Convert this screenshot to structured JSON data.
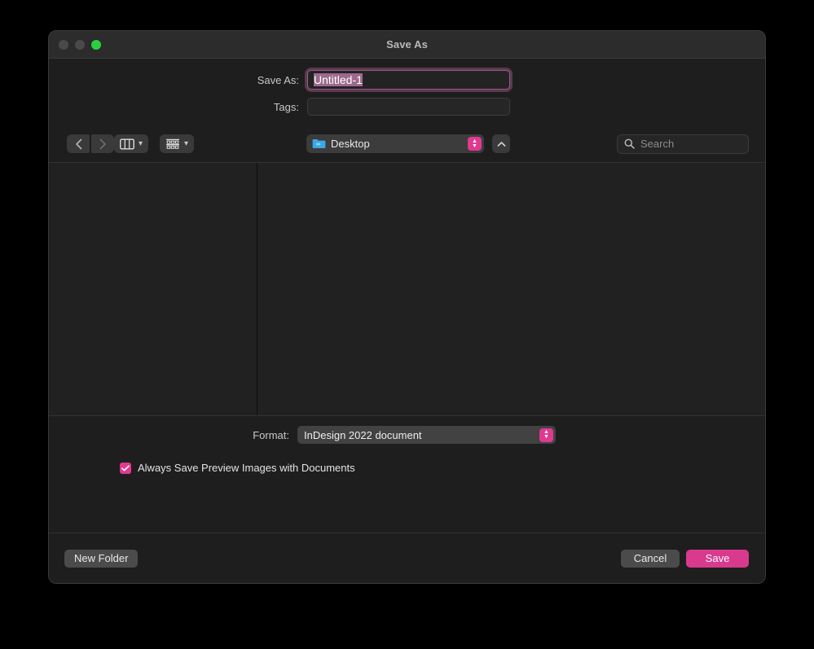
{
  "window": {
    "title": "Save As",
    "traffic_lights": [
      {
        "name": "close",
        "color": "#4a4a4a",
        "enabled": false
      },
      {
        "name": "minimize",
        "color": "#4a4a4a",
        "enabled": false
      },
      {
        "name": "zoom",
        "color": "#2ad13f",
        "enabled": true
      }
    ]
  },
  "fields": {
    "save_as_label": "Save As:",
    "save_as_value": "Untitled-1",
    "save_as_selected": true,
    "tags_label": "Tags:",
    "tags_value": "",
    "tags_placeholder": ""
  },
  "toolbar": {
    "back_icon": "chevron-left",
    "forward_icon": "chevron-right",
    "view_icon": "column-view",
    "view_chevron": "chevron-down",
    "group_icon": "group-by-grid",
    "group_chevron": "chevron-down",
    "location_label": "Desktop",
    "location_icon": "folder-icon",
    "expand_icon": "chevron-up",
    "search_placeholder": "Search",
    "search_icon": "magnifier"
  },
  "format": {
    "label": "Format:",
    "value": "InDesign 2022 document",
    "checkbox_label": "Always Save Preview Images with Documents",
    "checkbox_checked": true
  },
  "buttons": {
    "new_folder": "New Folder",
    "cancel": "Cancel",
    "save": "Save"
  },
  "colors": {
    "accent": "#d93a8e",
    "stepper": "#e0398f",
    "window_bg": "#1e1e1e",
    "titlebar_bg": "#2c2c2c",
    "browser_bg": "#212121",
    "folder_blue": "#3ba7e6",
    "zoom_green": "#2ad13f"
  }
}
